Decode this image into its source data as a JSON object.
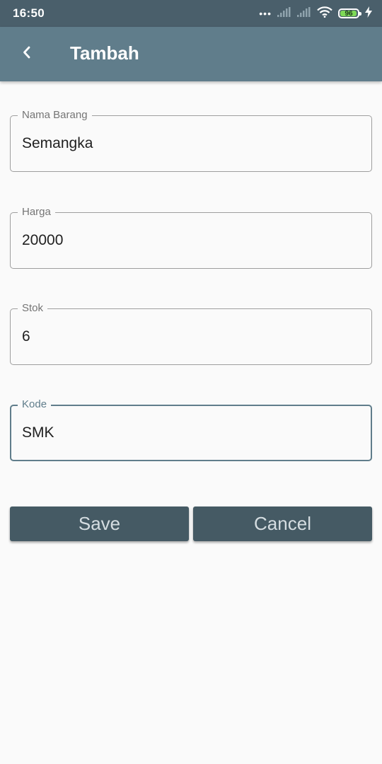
{
  "status_bar": {
    "time": "16:50",
    "signal_dots": "•••",
    "battery_level": "96",
    "battery_fraction": 0.96,
    "icons": [
      "more-dots-icon",
      "signal-1-icon",
      "signal-2-icon",
      "wifi-icon",
      "battery-icon",
      "charging-bolt-icon"
    ]
  },
  "app_bar": {
    "title": "Tambah",
    "back_icon": "back-chevron-icon"
  },
  "form": {
    "fields": [
      {
        "label": "Nama Barang",
        "value": "Semangka"
      },
      {
        "label": "Harga",
        "value": "20000"
      },
      {
        "label": "Stok",
        "value": "6"
      },
      {
        "label": "Kode",
        "value": "SMK"
      }
    ],
    "focused_field": "Kode"
  },
  "buttons": {
    "save_label": "Save",
    "cancel_label": "Cancel"
  },
  "colors": {
    "status_bar": "#4a5f6b",
    "app_bar": "#607d8b",
    "button": "#455a64",
    "background": "#fafafa",
    "battery": "#7ed957"
  }
}
